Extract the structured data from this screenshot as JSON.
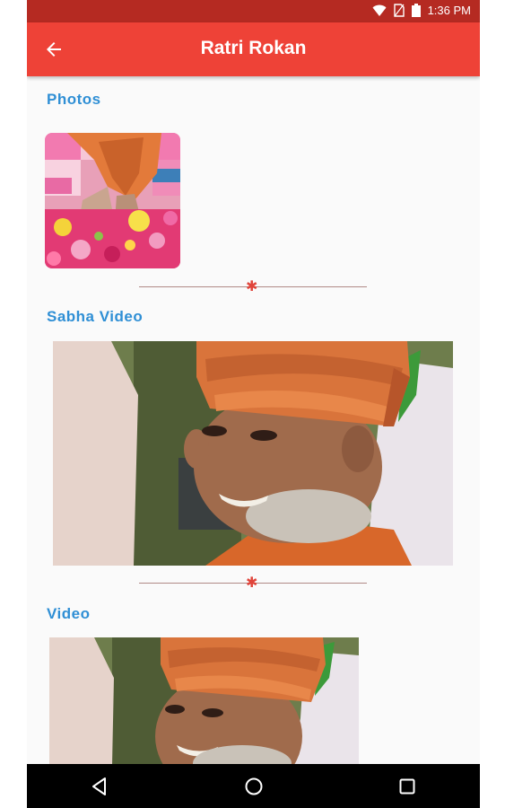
{
  "status_bar": {
    "time": "1:36 PM",
    "icons": [
      "wifi-icon",
      "no-sim-icon",
      "battery-icon"
    ]
  },
  "app_bar": {
    "title": "Ratri Rokan",
    "back_icon": "arrow-back-icon"
  },
  "sections": {
    "photos": "Photos",
    "sabha_video": "Sabha Video",
    "video": "Video"
  },
  "nav_bar": {
    "icons": [
      "back-triangle-icon",
      "home-circle-icon",
      "recents-square-icon"
    ]
  },
  "colors": {
    "status_bar": "#b52a22",
    "app_bar": "#ee4237",
    "section_title": "#2f8fd5",
    "divider_star": "#e0443a"
  }
}
